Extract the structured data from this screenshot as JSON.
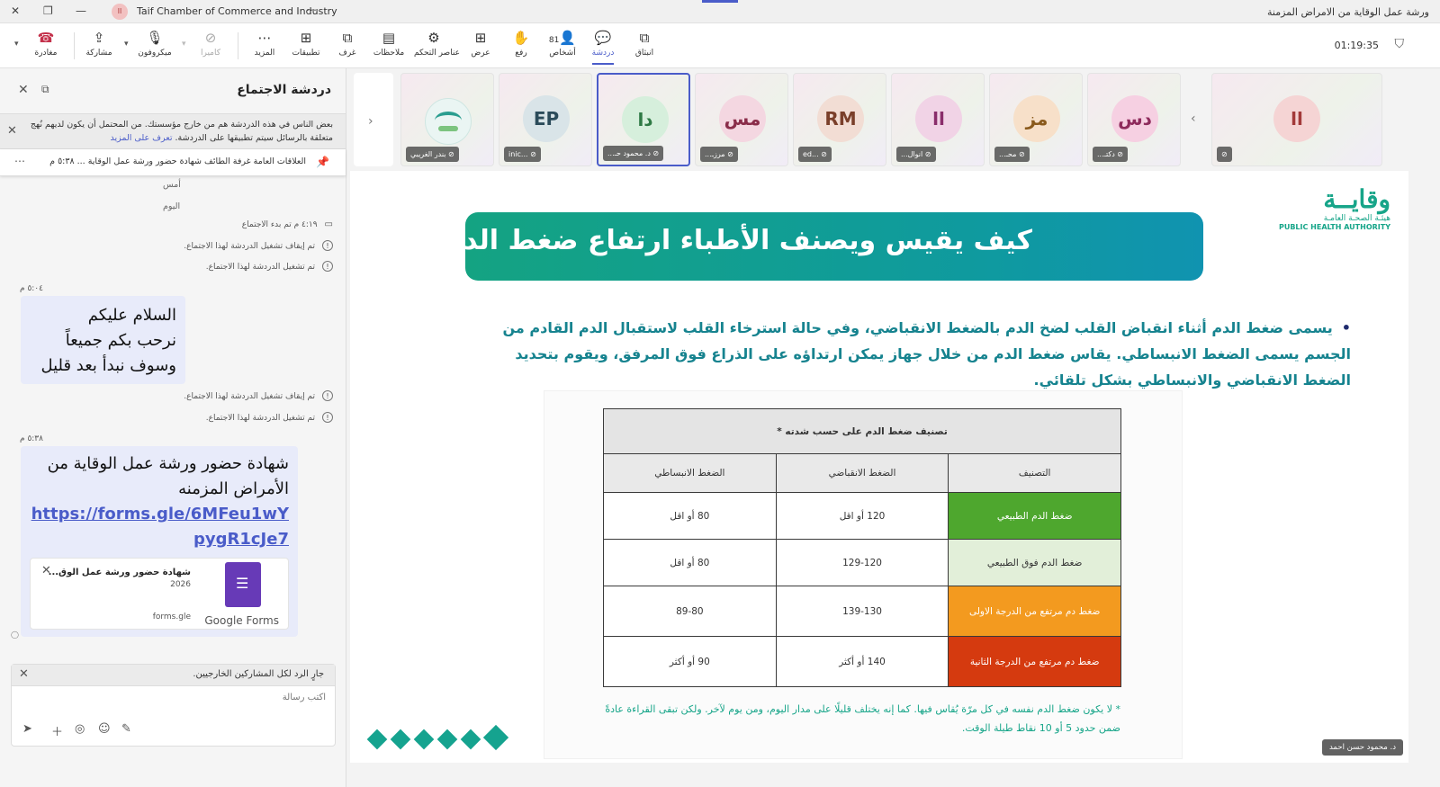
{
  "window": {
    "org_name": "Taif Chamber of Commerce and Industry",
    "org_initials": "اا",
    "meeting_title": "ورشة عمل الوقاية من الامراض المزمنة"
  },
  "toolbar": {
    "timer": "01:19:35",
    "leave": "مغادرة",
    "share": "مشاركة",
    "mic": "ميكروفون",
    "camera": "كاميرا",
    "more": "المزيد",
    "apps": "تطبيقات",
    "rooms": "غرف",
    "notes": "ملاحظات",
    "controls": "عناصر التحكم",
    "view": "عرض",
    "raise": "رفع",
    "people": "أشخاص",
    "people_count": "81",
    "chat": "دردشة",
    "popout": "انبثاق"
  },
  "chat": {
    "title": "دردشة الاجتماع",
    "notice": "بعض الناس في هذه الدردشة هم من خارج مؤسستك. من المحتمل أن يكون لديهم نُهج متعلقة بالرسائل سيتم تطبيقها على الدردشة.",
    "notice_link": "تعرف على المزيد",
    "pinned": "العلاقات العامة غرفة الطائف    شهادة حضور ورشة عمل الوقاية ... ٥:٣٨ م",
    "day_yesterday": "أمس",
    "day_today": "اليوم",
    "sys1": "٤:١٩ م  تم بدء الاجتماع",
    "sys2": "تم إيقاف تشغيل الدردشة لهذا الاجتماع.",
    "sys3": "تم تشغيل الدردشة لهذا الاجتماع.",
    "time1": "٥:٠٤ م",
    "msg1_line1": "السلام عليكم",
    "msg1_line2": "نرحب بكم جميعاً",
    "msg1_line3": "وسوف نبدأ بعد قليل",
    "sys4": "تم إيقاف تشغيل الدردشة لهذا الاجتماع.",
    "sys5": "تم تشغيل الدردشة لهذا الاجتماع.",
    "time2": "٥:٣٨ م",
    "msg2_text": "شهادة حضور ورشة عمل الوقاية من الأمراض المزمنه",
    "msg2_link": "https://forms.gle/6MFeu1wYpygR1cJe7",
    "card_title": "شهادة حضور ورشة عمل الوق...",
    "card_year": "2026",
    "card_site": "forms.gle",
    "card_brand": "Google Forms",
    "reply_to": "جارٍ الرد لكل المشاركين الخارجيين.",
    "input_placeholder": "اكتب رسالة"
  },
  "participants": [
    {
      "initials": "",
      "name": "بندر الغريبي",
      "logo": true
    },
    {
      "initials": "EP",
      "name": "...inic",
      "color": "#d9e4e8",
      "text": "#2b4b5a"
    },
    {
      "initials": "دا",
      "name": "د. محمود حـ...",
      "color": "#d6efdc",
      "text": "#2f7a45"
    },
    {
      "initials": "مس",
      "name": "مرزـ...",
      "color": "#f4d7e1",
      "text": "#8a2d4a"
    },
    {
      "initials": "RM",
      "name": "...ed",
      "color": "#f2ddd4",
      "text": "#7a3f2a"
    },
    {
      "initials": "اا",
      "name": "انوال...",
      "color": "#f1d3e6",
      "text": "#8a2d6b"
    },
    {
      "initials": "مز",
      "name": "محـ...",
      "color": "#f7e0c9",
      "text": "#8a5a1c"
    },
    {
      "initials": "دس",
      "name": "دكتـ...",
      "color": "#f6d0e2",
      "text": "#8e2b5c"
    },
    {
      "initials": "اا",
      "name": "",
      "color": "#f5d4d4",
      "text": "#a33a3a"
    }
  ],
  "slide": {
    "logo_ar": "وقايــة",
    "logo_ar_sub": "هيئـة الصحـة العامـة",
    "logo_en": "PUBLIC HEALTH AUTHORITY",
    "title": "كيف يقيس ويصنف الأطباء ارتفاع ضغط الدم؟",
    "bullet": "يسمى ضغط الدم أثناء انقباض القلب لضخ الدم بالضغط الانقباضي، وفي حالة استرخاء القلب لاستقبال الدم القادم من الجسم يسمى الضغط الانبساطي. يقاس ضغط الدم من خلال جهاز يمكن ارتداؤه على الذراع فوق المرفق، ويقوم بتحديد الضغط الانقباضي والانبساطي بشكل تلقائي.",
    "table_caption": "تصنيف ضغط الدم على حسب شدته *",
    "headers": [
      "التصنيف",
      "الضغط الانقباضي",
      "الضغط الانبساطي"
    ],
    "rows": [
      {
        "label": "ضغط الدم الطبيعي",
        "sys": "120 أو اقل",
        "dia": "80 أو اقل",
        "color": "#4ea72e",
        "text_color": "#ffffff"
      },
      {
        "label": "ضغط الدم فوق الطبيعي",
        "sys": "129-120",
        "dia": "80 أو اقل",
        "color": "#e2efd9",
        "text_color": "#333333"
      },
      {
        "label": "ضغط دم مرتفع من الدرجة الاولى",
        "sys": "139-130",
        "dia": "89-80",
        "color": "#f39a1f",
        "text_color": "#ffffff"
      },
      {
        "label": "ضغط دم مرتفع من الدرجة الثانية",
        "sys": "140 أو أكثر",
        "dia": "90 أو أكثر",
        "color": "#d53a0f",
        "text_color": "#ffffff"
      }
    ],
    "footnote": "* لا يكون ضغط الدم نفسه في كل مرّة يُقاس فيها. كما إنه يختلف قليلًا على مدار اليوم، ومن يوم لآخر. ولكن تبقى القراءة عادةً ضمن حدود 5 أو 10 نقاط طيلة الوقت.",
    "presenter": "د. محمود حسن احمد"
  }
}
